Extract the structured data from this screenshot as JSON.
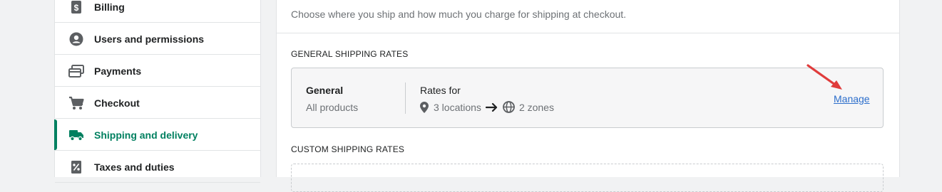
{
  "sidebar": {
    "items": [
      {
        "label": "Billing",
        "icon": "dollar-document-icon",
        "active": false
      },
      {
        "label": "Users and permissions",
        "icon": "user-circle-icon",
        "active": false
      },
      {
        "label": "Payments",
        "icon": "payment-card-icon",
        "active": false
      },
      {
        "label": "Checkout",
        "icon": "cart-icon",
        "active": false
      },
      {
        "label": "Shipping and delivery",
        "icon": "truck-icon",
        "active": true
      },
      {
        "label": "Taxes and duties",
        "icon": "percent-receipt-icon",
        "active": false
      }
    ]
  },
  "main": {
    "header": {
      "description": "Choose where you ship and how much you charge for shipping at checkout."
    },
    "general_section_label": "GENERAL SHIPPING RATES",
    "general_card": {
      "name": "General",
      "subtitle": "All products",
      "rates_label": "Rates for",
      "locations": "3 locations",
      "zones": "2 zones",
      "manage_label": "Manage"
    },
    "custom_section_label": "CUSTOM SHIPPING RATES"
  },
  "colors": {
    "accent": "#008060",
    "link": "#2c6ecb",
    "annotation_arrow": "#e03c3c"
  }
}
